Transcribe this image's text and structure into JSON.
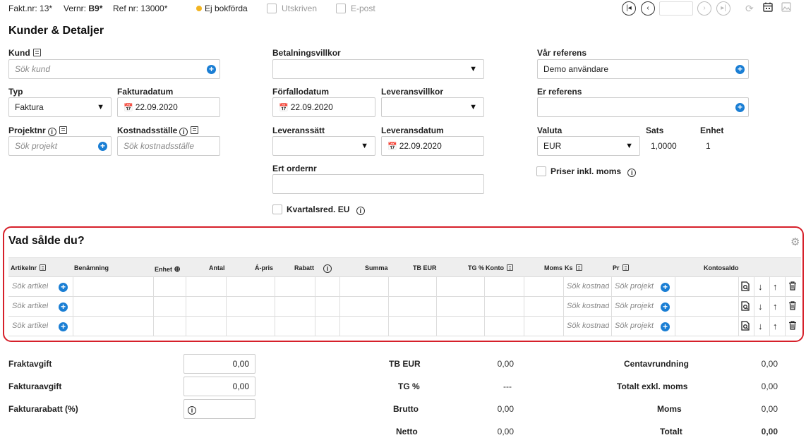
{
  "topbar": {
    "fakt_label": "Fakt.nr:",
    "fakt_value": "13*",
    "vernr_label": "Vernr:",
    "vernr_value": "B9*",
    "ref_label": "Ref nr:",
    "ref_value": "13000*",
    "status": "Ej bokförda",
    "utskriven": "Utskriven",
    "epost": "E-post",
    "status_color": "#f2b422"
  },
  "title": "Kunder & Detaljer",
  "form": {
    "kund_label": "Kund",
    "kund_placeholder": "Sök kund",
    "typ_label": "Typ",
    "typ_value": "Faktura",
    "fakturadatum_label": "Fakturadatum",
    "fakturadatum_value": "22.09.2020",
    "projektnr_label": "Projektnr",
    "projekt_placeholder": "Sök projekt",
    "kostnadsstalle_label": "Kostnadsställe",
    "kostnadsstalle_placeholder": "Sök kostnadsställe",
    "betalningsvillkor_label": "Betalningsvillkor",
    "betalningsvillkor_value": "",
    "forfallodatum_label": "Förfallodatum",
    "forfallodatum_value": "22.09.2020",
    "leveransvillkor_label": "Leveransvillkor",
    "leveranssatt_label": "Leveranssätt",
    "leveransdatum_label": "Leveransdatum",
    "leveransdatum_value": "22.09.2020",
    "ert_ordernr_label": "Ert ordernr",
    "kvartalsred_label": "Kvartalsred. EU",
    "var_referens_label": "Vår referens",
    "var_referens_value": "Demo användare",
    "er_referens_label": "Er referens",
    "valuta_label": "Valuta",
    "valuta_value": "EUR",
    "sats_label": "Sats",
    "sats_value": "1,0000",
    "enhet_label": "Enhet",
    "enhet_value": "1",
    "priser_label": "Priser inkl. moms"
  },
  "items": {
    "title": "Vad sålde du?",
    "headers": {
      "artikelnr": "Artikelnr",
      "benamning": "Benämning",
      "enhet": "Enhet",
      "antal": "Antal",
      "apris": "Á-pris",
      "rabatt": "Rabatt",
      "summa": "Summa",
      "tb_eur": "TB EUR",
      "tg": "TG %",
      "konto": "Konto",
      "moms": "Moms",
      "ks": "Ks",
      "pr": "Pr",
      "kontosaldo": "Kontosaldo"
    },
    "rows": [
      {
        "artikel_ph": "Sök artikel",
        "kost_ph": "Sök kostnads",
        "projekt_ph": "Sök projekt"
      },
      {
        "artikel_ph": "Sök artikel",
        "kost_ph": "Sök kostnads",
        "projekt_ph": "Sök projekt"
      },
      {
        "artikel_ph": "Sök artikel",
        "kost_ph": "Sök kostnads",
        "projekt_ph": "Sök projekt"
      }
    ]
  },
  "totals": {
    "fraktavgift_label": "Fraktavgift",
    "fraktavgift_value": "0,00",
    "fakturaavgift_label": "Fakturaavgift",
    "fakturaavgift_value": "0,00",
    "fakturarabatt_label": "Fakturarabatt (%)",
    "tb_eur_label": "TB EUR",
    "tb_eur_value": "0,00",
    "tg_label": "TG %",
    "tg_value": "---",
    "brutto_label": "Brutto",
    "brutto_value": "0,00",
    "netto_label": "Netto",
    "netto_value": "0,00",
    "centavrundning_label": "Centavrundning",
    "centavrundning_value": "0,00",
    "totalt_exkl_label": "Totalt exkl. moms",
    "totalt_exkl_value": "0,00",
    "moms_label": "Moms",
    "moms_value": "0,00",
    "totalt_label": "Totalt",
    "totalt_value": "0,00"
  }
}
